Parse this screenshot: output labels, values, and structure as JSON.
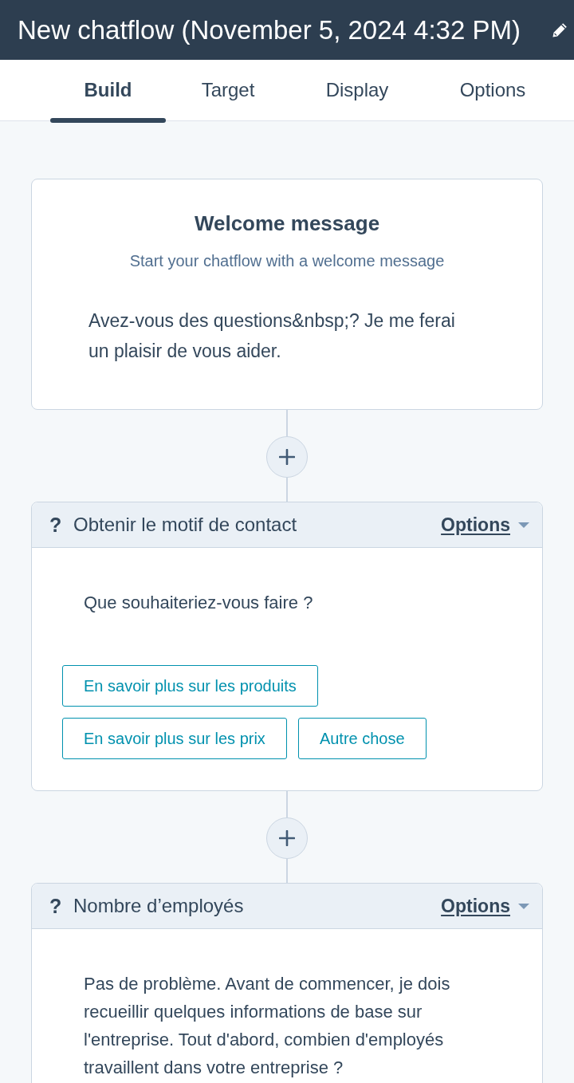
{
  "header": {
    "title": "New chatflow (November 5, 2024 4:32 PM)"
  },
  "tabs": [
    {
      "label": "Build",
      "selected": true
    },
    {
      "label": "Target",
      "selected": false
    },
    {
      "label": "Display",
      "selected": false
    },
    {
      "label": "Options",
      "selected": false
    }
  ],
  "welcome_card": {
    "title": "Welcome message",
    "subtitle": "Start your chatflow with a welcome message",
    "message": "Avez-vous des questions&nbsp;? Je me ferai un plaisir de vous aider."
  },
  "steps": [
    {
      "marker": "?",
      "title": "Obtenir le motif de contact",
      "options_label": "Options",
      "message": "Que souhaiteriez-vous faire ?",
      "choices": [
        "En savoir plus sur les produits",
        "En savoir plus sur les prix",
        "Autre chose"
      ]
    },
    {
      "marker": "?",
      "title": "Nombre d’employés",
      "options_label": "Options",
      "message": "Pas de problème. Avant de commencer, je dois recueillir quelques informations de base sur l'entreprise. Tout d'abord, combien d'employés travaillent dans votre entreprise ?"
    }
  ]
}
